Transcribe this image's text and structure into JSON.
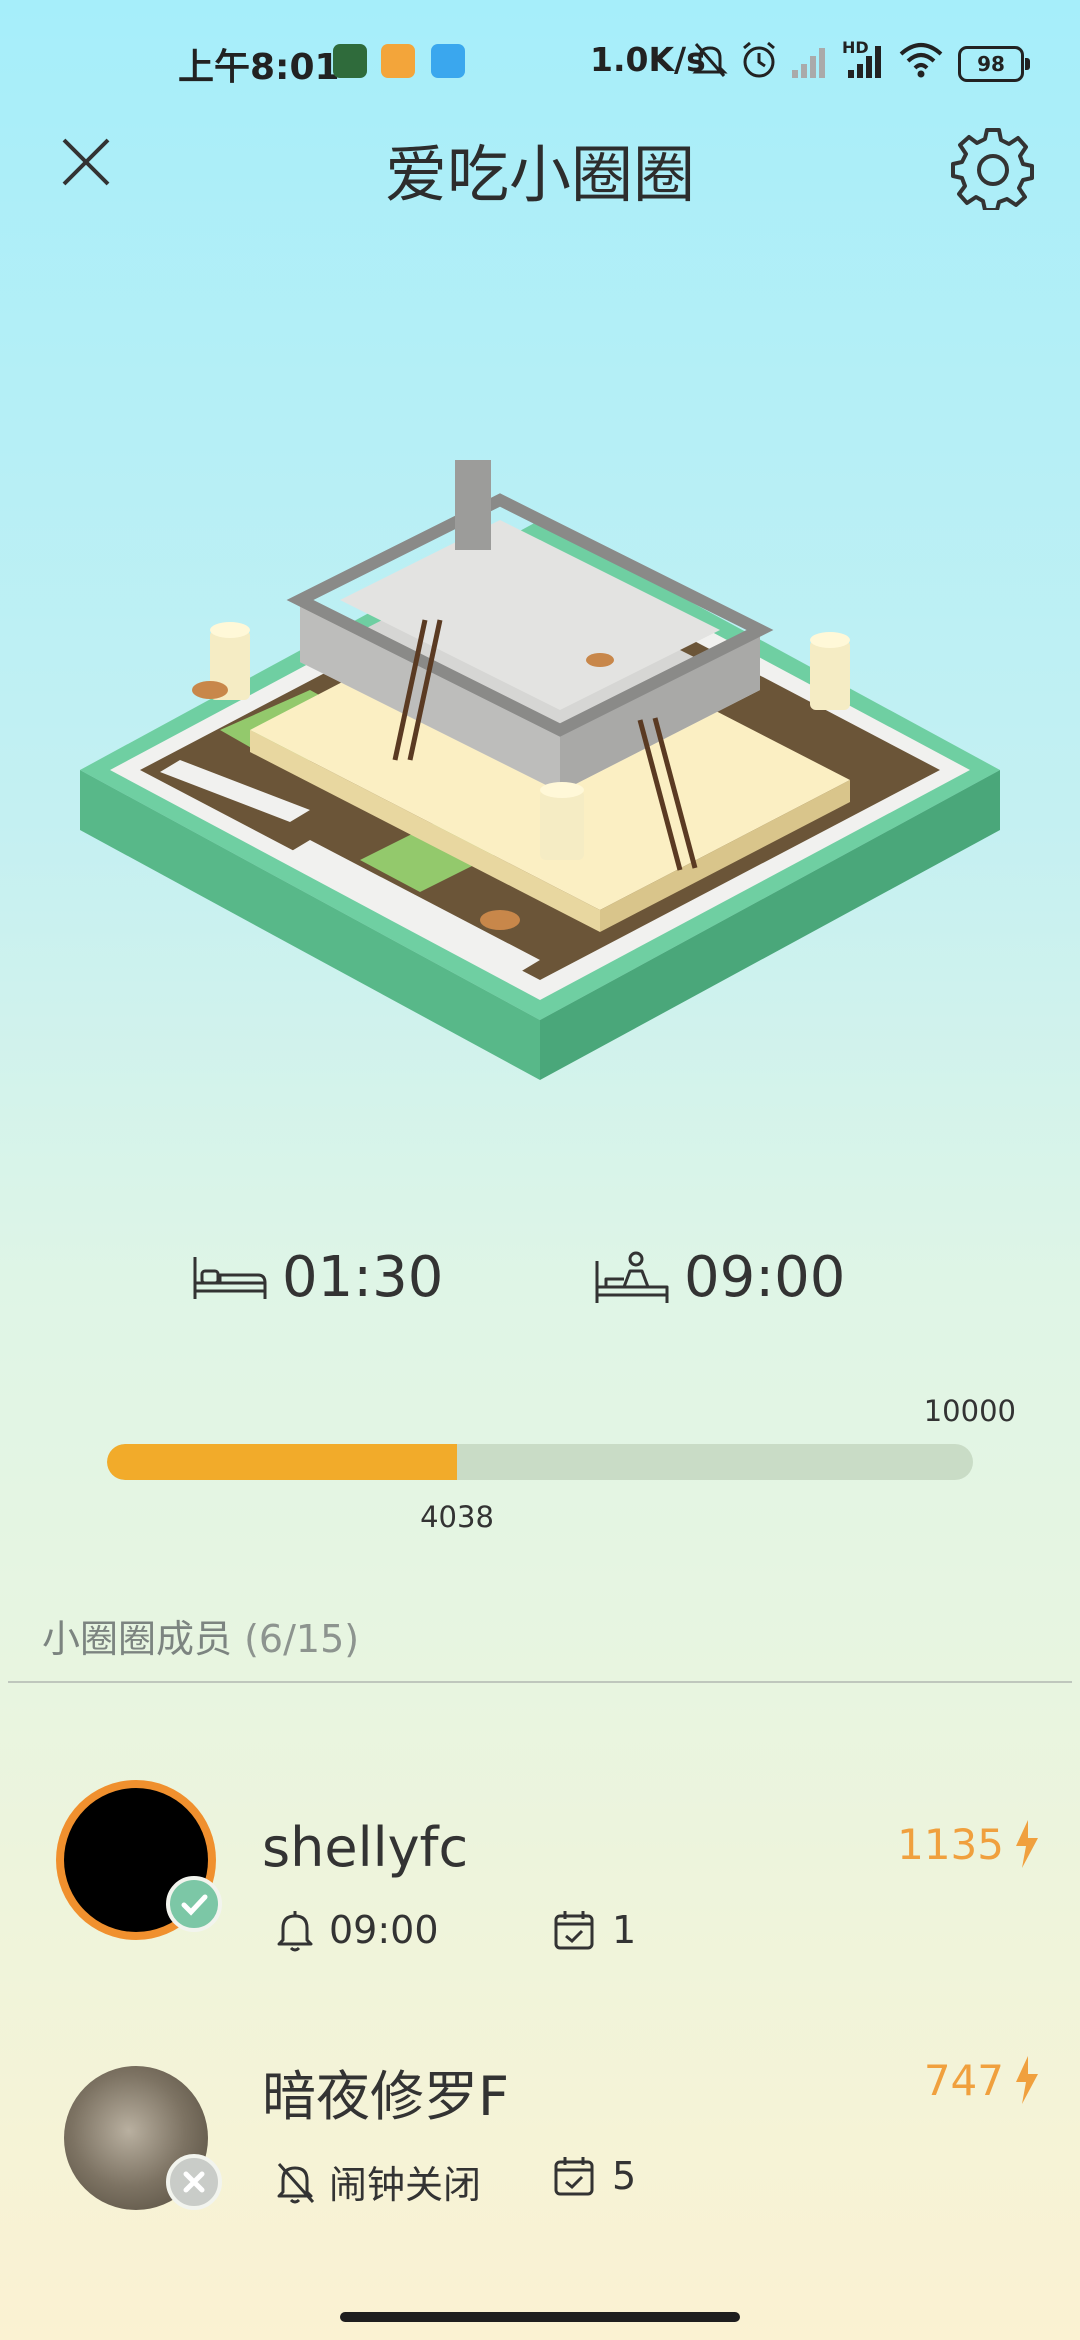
{
  "status_bar": {
    "time": "上午8:01",
    "network_speed": "1.0K/s",
    "signal_label": "HD",
    "battery": "98"
  },
  "header": {
    "title": "爱吃小圈圈",
    "close_icon": "close-icon",
    "settings_icon": "gear-icon"
  },
  "sleep": {
    "bedtime": "01:30",
    "wake_time": "09:00",
    "bed_icon": "bed-icon",
    "wake_icon": "wake-up-icon"
  },
  "progress": {
    "goal": "10000",
    "current": "4038",
    "fraction": 0.4038,
    "fill_color": "#f2ab2a"
  },
  "members": {
    "title": "小圈圈成员",
    "count": "(6/15)",
    "list": [
      {
        "name": "shellyfc",
        "score": "1135",
        "alarm": "09:00",
        "days": "1",
        "alarm_icon": "bell-icon",
        "calendar_icon": "calendar-check-icon",
        "badge": "check-badge-icon"
      },
      {
        "name": "暗夜修罗F",
        "score": "747",
        "alarm": "闹钟关闭",
        "days": "5",
        "alarm_icon": "bell-off-icon",
        "calendar_icon": "calendar-check-icon",
        "badge": "cross-badge-icon"
      }
    ]
  },
  "colors": {
    "accent": "#f0a03e",
    "progress_track": "#c9dcc6",
    "badge_green": "#7cc7a6",
    "badge_gray": "#c9ccc8"
  }
}
